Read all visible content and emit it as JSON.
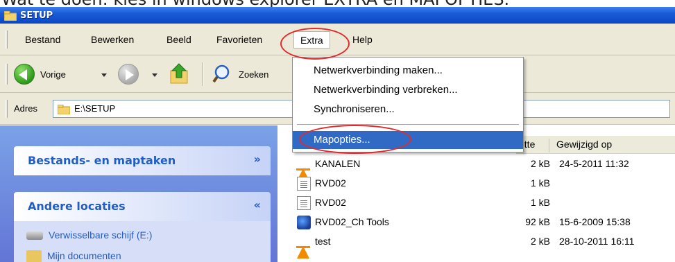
{
  "caption": "Wat te doen: kies in windows explorer EXTRA en MAPOPTIES.",
  "window": {
    "title": "SETUP"
  },
  "menubar": {
    "items": [
      "Bestand",
      "Bewerken",
      "Beeld",
      "Favorieten",
      "Extra",
      "Help"
    ],
    "active": "Extra"
  },
  "toolbar": {
    "back_label": "Vorige",
    "search_label": "Zoeken"
  },
  "address": {
    "label": "Adres",
    "value": "E:\\SETUP"
  },
  "dropdown": {
    "items": [
      "Netwerkverbinding maken...",
      "Netwerkverbinding verbreken...",
      "Synchroniseren...",
      "Mapopties..."
    ],
    "selected": "Mapopties..."
  },
  "taskpane": {
    "panels": [
      {
        "title": "Bestands- en maptaken",
        "chevron": "»"
      },
      {
        "title": "Andere locaties",
        "chevron": "«"
      }
    ],
    "locations": [
      "Verwisselbare schijf (E:)",
      "Mijn documenten"
    ]
  },
  "list": {
    "columns": [
      "Grootte",
      "Gewijzigd op"
    ],
    "columns_visible": [
      "otte",
      "Gewijzigd op"
    ],
    "rows": [
      {
        "name": "KANALEN",
        "size": "2 kB",
        "modified": "24-5-2011 11:32",
        "icon": "vlc-cone-icon"
      },
      {
        "name": "RVD02",
        "size": "1 kB",
        "modified": "",
        "icon": "shortcut-file-icon"
      },
      {
        "name": "RVD02",
        "size": "1 kB",
        "modified": "",
        "icon": "text-file-icon"
      },
      {
        "name": "RVD02_Ch Tools",
        "size": "92 kB",
        "modified": "15-6-2009 15:38",
        "icon": "tools-app-icon"
      },
      {
        "name": "test",
        "size": "2 kB",
        "modified": "28-10-2011 16:11",
        "icon": "vlc-cone-icon"
      }
    ]
  },
  "colors": {
    "titlebar": "#0a47c5",
    "menu_bg": "#ece9d8",
    "highlight": "#316ac5",
    "annotation": "#e32a2a"
  }
}
